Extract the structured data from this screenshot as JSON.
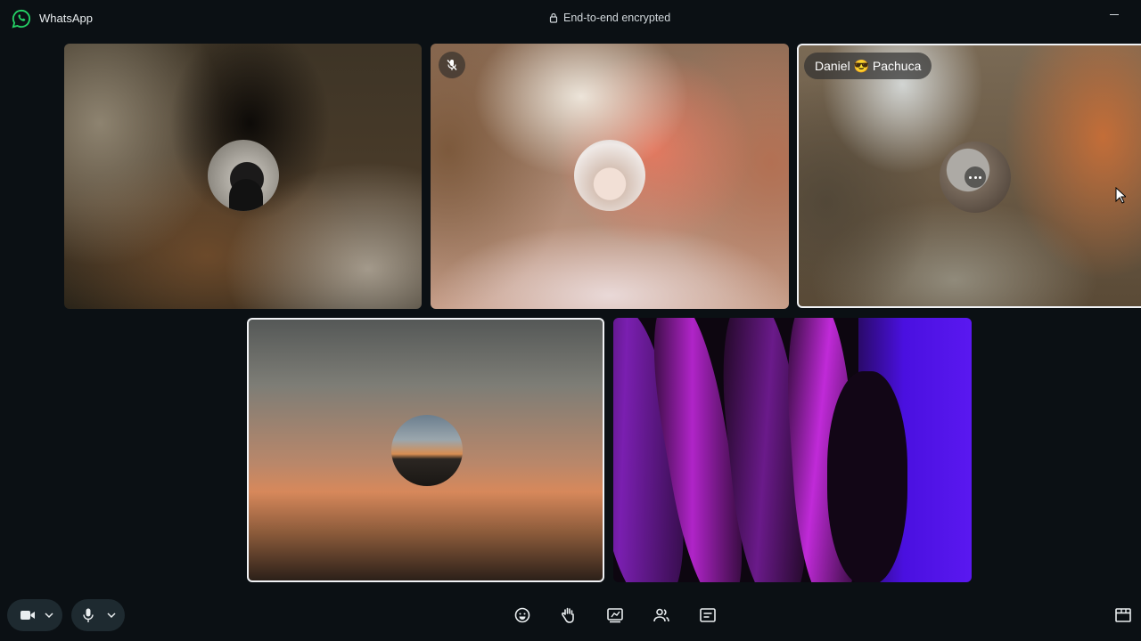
{
  "app": {
    "title": "WhatsApp"
  },
  "call": {
    "encryption_text": "End-to-end encrypted",
    "participants": [
      {
        "id": "p1",
        "muted": false,
        "selected": false
      },
      {
        "id": "p2",
        "muted": true,
        "selected": false
      },
      {
        "id": "p3",
        "name": "Daniel 😎 Pachuca",
        "selected": true,
        "hover_menu": true
      },
      {
        "id": "p4",
        "muted": false,
        "selected": true
      },
      {
        "id": "p5",
        "video_on": true,
        "selected": false
      }
    ]
  },
  "controls": {
    "left": [
      "video-camera-icon",
      "chevron-down-icon",
      "microphone-icon",
      "chevron-down-icon"
    ],
    "center": [
      "emoji-reaction-icon",
      "raise-hand-icon",
      "screen-share-icon",
      "participants-icon",
      "call-chat-icon"
    ],
    "right": [
      "layout-icon"
    ]
  },
  "colors": {
    "background": "#0b1014",
    "pill": "#1e2a30",
    "whatsapp_green": "#25d366",
    "selected_border": "#f0f2f5"
  }
}
